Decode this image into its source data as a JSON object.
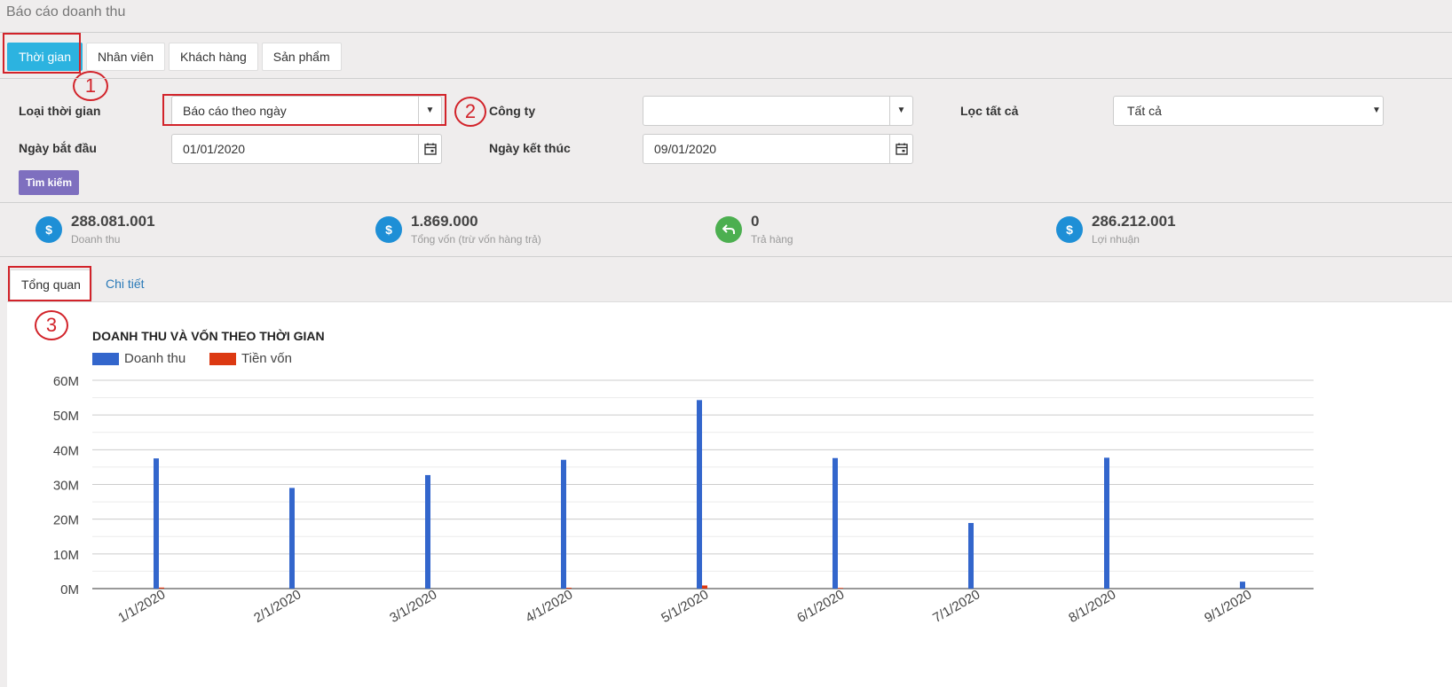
{
  "page_title": "Báo cáo doanh thu",
  "tabs": [
    {
      "label": "Thời gian",
      "active": true
    },
    {
      "label": "Nhân viên",
      "active": false
    },
    {
      "label": "Khách hàng",
      "active": false
    },
    {
      "label": "Sản phẩm",
      "active": false
    }
  ],
  "annotations": [
    "1",
    "2",
    "3"
  ],
  "filters": {
    "time_type_label": "Loại thời gian",
    "time_type_value": "Báo cáo theo ngày",
    "company_label": "Công ty",
    "company_value": "",
    "filter_all_label": "Lọc tất cả",
    "filter_all_value": "Tất cả",
    "start_label": "Ngày bắt đầu",
    "start_value": "01/01/2020",
    "end_label": "Ngày kết thúc",
    "end_value": "09/01/2020",
    "search_label": "Tìm kiếm"
  },
  "stats": [
    {
      "value": "288.081.001",
      "label": "Doanh thu",
      "icon": "dollar-icon",
      "color": "#1e8fd6"
    },
    {
      "value": "1.869.000",
      "label": "Tổng vốn (trừ vốn hàng trả)",
      "icon": "dollar-icon",
      "color": "#1e8fd6"
    },
    {
      "value": "0",
      "label": "Trả hàng",
      "icon": "return-icon",
      "color": "#4caf50"
    },
    {
      "value": "286.212.001",
      "label": "Lợi nhuận",
      "icon": "dollar-icon",
      "color": "#1e8fd6"
    }
  ],
  "sub_tabs": {
    "overview": "Tổng quan",
    "detail": "Chi tiết"
  },
  "colors": {
    "accent": "#2cb3e0",
    "search_button": "#7e6fbf",
    "annotation": "#d2232a"
  },
  "chart_data": {
    "type": "bar",
    "title": "DOANH THU VÀ VỐN THEO THỜI GIAN",
    "categories": [
      "1/1/2020",
      "2/1/2020",
      "3/1/2020",
      "4/1/2020",
      "5/1/2020",
      "6/1/2020",
      "7/1/2020",
      "8/1/2020",
      "9/1/2020"
    ],
    "series": [
      {
        "name": "Doanh thu",
        "color": "#3366cc",
        "values": [
          37500000,
          29000000,
          32700000,
          37100000,
          54300000,
          37600000,
          18900000,
          37700000,
          2000000
        ]
      },
      {
        "name": "Tiền vốn",
        "color": "#dc3912",
        "values": [
          300000,
          0,
          0,
          250000,
          900000,
          200000,
          0,
          0,
          0
        ]
      }
    ],
    "yticks": [
      "0M",
      "10M",
      "20M",
      "30M",
      "40M",
      "50M",
      "60M"
    ],
    "ylim": [
      0,
      60000000
    ],
    "grid": true,
    "legend": "top-left"
  }
}
